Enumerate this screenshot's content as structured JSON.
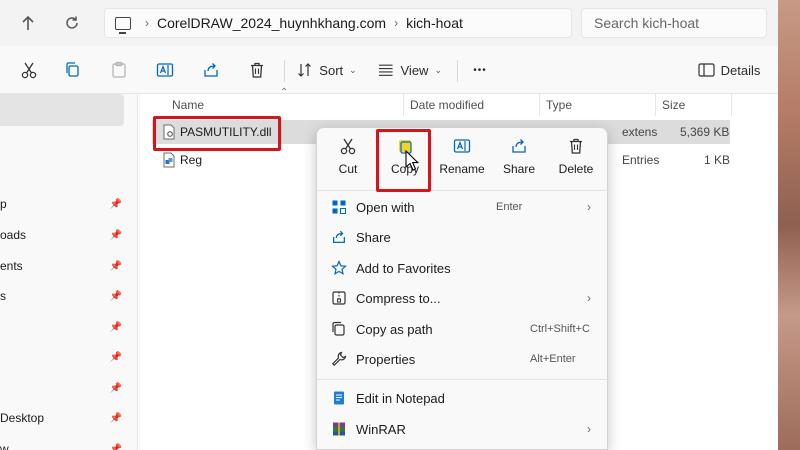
{
  "address": {
    "segments": [
      "CorelDRAW_2024_huynhkhang.com",
      "kich-hoat"
    ]
  },
  "search": {
    "placeholder": "Search kich-hoat"
  },
  "toolbar": {
    "sort_label": "Sort",
    "view_label": "View",
    "more_label": "•••",
    "details_label": "Details"
  },
  "sidebar": {
    "items": [
      {
        "label": "p",
        "pinned": true
      },
      {
        "label": "oads",
        "pinned": true
      },
      {
        "label": "ents",
        "pinned": true
      },
      {
        "label": "s",
        "pinned": true
      },
      {
        "label": "",
        "pinned": true
      },
      {
        "label": "",
        "pinned": true
      },
      {
        "label": "",
        "pinned": true
      },
      {
        "label": "Desktop",
        "pinned": true
      },
      {
        "label": "w",
        "pinned": true
      }
    ]
  },
  "filelist": {
    "columns": [
      "Name",
      "Date modified",
      "Type",
      "Size"
    ],
    "rows": [
      {
        "name": "PASMUTILITY.dll",
        "date": "",
        "type": "extens",
        "size": "5,369 KB",
        "selected": true,
        "icon": "dll-file-icon"
      },
      {
        "name": "Reg",
        "date": "",
        "type": "Entries",
        "size": "1 KB",
        "selected": false,
        "icon": "registry-file-icon"
      }
    ]
  },
  "context_menu": {
    "actions": [
      {
        "label": "Cut",
        "icon": "scissors-icon"
      },
      {
        "label": "Copy",
        "icon": "copy-icon"
      },
      {
        "label": "Rename",
        "icon": "rename-icon"
      },
      {
        "label": "Share",
        "icon": "share-icon"
      },
      {
        "label": "Delete",
        "icon": "trash-icon"
      }
    ],
    "items": [
      {
        "label": "Open with",
        "shortcut": "Enter",
        "arrow": true,
        "icon": "open-with-icon"
      },
      {
        "label": "Share",
        "shortcut": "",
        "arrow": false,
        "icon": "share-icon"
      },
      {
        "label": "Add to Favorites",
        "shortcut": "",
        "arrow": false,
        "icon": "star-icon"
      },
      {
        "label": "Compress to...",
        "shortcut": "",
        "arrow": true,
        "icon": "zip-icon"
      },
      {
        "label": "Copy as path",
        "shortcut": "Ctrl+Shift+C",
        "arrow": false,
        "icon": "copy-path-icon"
      },
      {
        "label": "Properties",
        "shortcut": "Alt+Enter",
        "arrow": false,
        "icon": "wrench-icon"
      },
      {
        "label": "Edit in Notepad",
        "shortcut": "",
        "arrow": false,
        "icon": "notepad-icon"
      },
      {
        "label": "WinRAR",
        "shortcut": "",
        "arrow": true,
        "icon": "winrar-icon"
      }
    ]
  },
  "colors": {
    "highlight_red": "#d8141b",
    "accent_blue": "#0067c0"
  }
}
